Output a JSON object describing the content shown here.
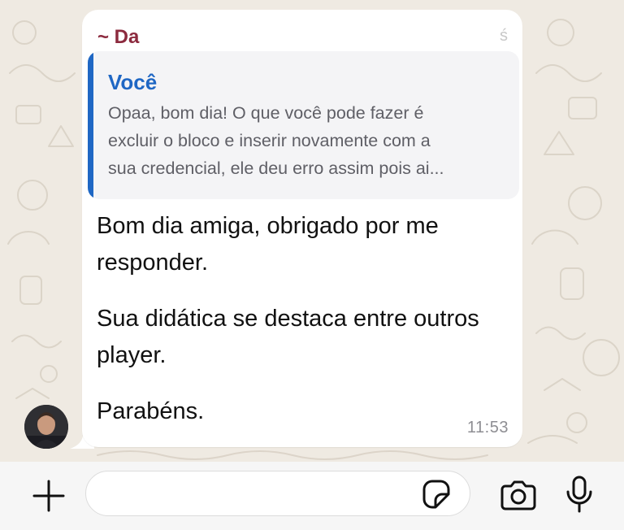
{
  "chat": {
    "sender_name": "~ Da",
    "sender_name_fragment": "ś",
    "quoted_message": {
      "author": "Você",
      "lines": [
        "Opaa, bom dia! O que você pode fazer é",
        "excluir o bloco e inserir novamente com a",
        "sua credencial, ele deu erro assim pois ai..."
      ]
    },
    "message": {
      "paragraphs": [
        "Bom dia amiga, obrigado por me responder.",
        "Sua didática se destaca entre outros player.",
        "Parabéns."
      ],
      "time": "11:53"
    }
  },
  "icons": {
    "avatar": "user-avatar",
    "add": "plus-icon",
    "sticker": "sticker-icon",
    "camera": "camera-icon",
    "mic": "microphone-icon"
  },
  "colors": {
    "chat_background": "#efeae2",
    "bubble": "#ffffff",
    "sender_name": "#8c2a3e",
    "quote_accent": "#1f67c4",
    "quote_background": "#f4f4f6",
    "timestamp": "#8e8e93"
  }
}
